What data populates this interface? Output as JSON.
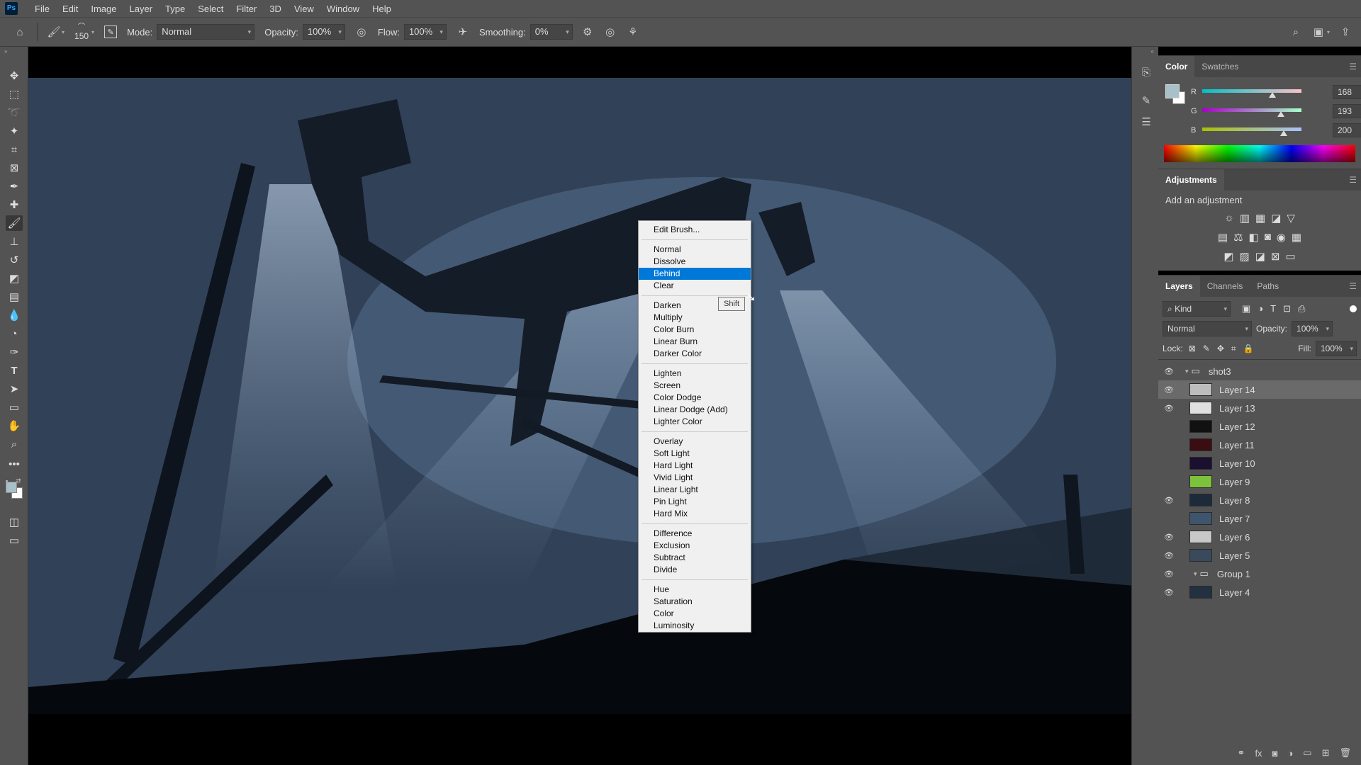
{
  "app_logo": "Ps",
  "menu": [
    "File",
    "Edit",
    "Image",
    "Layer",
    "Type",
    "Select",
    "Filter",
    "3D",
    "View",
    "Window",
    "Help"
  ],
  "options": {
    "brush_size": "150",
    "mode_label": "Mode:",
    "mode_value": "Normal",
    "opacity_label": "Opacity:",
    "opacity_value": "100%",
    "flow_label": "Flow:",
    "flow_value": "100%",
    "smoothing_label": "Smoothing:",
    "smoothing_value": "0%"
  },
  "color_panel": {
    "tabs": [
      "Color",
      "Swatches"
    ],
    "r_label": "R",
    "r_value": "168",
    "g_label": "G",
    "g_value": "193",
    "b_label": "B",
    "b_value": "200",
    "foreground": "#a8c1c8"
  },
  "adjustments_panel": {
    "title": "Adjustments",
    "subtitle": "Add an adjustment"
  },
  "layers_panel": {
    "tabs": [
      "Layers",
      "Channels",
      "Paths"
    ],
    "filter_label": "Kind",
    "blend_mode": "Normal",
    "opacity_label": "Opacity:",
    "opacity_value": "100%",
    "lock_label": "Lock:",
    "fill_label": "Fill:",
    "fill_value": "100%",
    "layers": [
      {
        "name": "shot3",
        "visible": true,
        "type": "group",
        "selected": false
      },
      {
        "name": "Layer 14",
        "visible": true,
        "type": "layer",
        "selected": true,
        "color": "#bdbdbd"
      },
      {
        "name": "Layer 13",
        "visible": true,
        "type": "layer",
        "selected": false,
        "color": "#e0e0e0"
      },
      {
        "name": "Layer 12",
        "visible": false,
        "type": "layer",
        "selected": false,
        "color": "#111111"
      },
      {
        "name": "Layer 11",
        "visible": false,
        "type": "layer",
        "selected": false,
        "color": "#3a0d12"
      },
      {
        "name": "Layer 10",
        "visible": false,
        "type": "layer",
        "selected": false,
        "color": "#1c1030"
      },
      {
        "name": "Layer 9",
        "visible": false,
        "type": "layer",
        "selected": false,
        "color": "#7cc23a"
      },
      {
        "name": "Layer 8",
        "visible": true,
        "type": "layer",
        "selected": false,
        "color": "#1d2a3a"
      },
      {
        "name": "Layer 7",
        "visible": false,
        "type": "layer",
        "selected": false,
        "color": "#3f556d"
      },
      {
        "name": "Layer 6",
        "visible": true,
        "type": "layer",
        "selected": false,
        "color": "#c8c8c8"
      },
      {
        "name": "Layer 5",
        "visible": true,
        "type": "layer",
        "selected": false,
        "color": "#3a4a5c"
      },
      {
        "name": "Group 1",
        "visible": true,
        "type": "group",
        "selected": false
      },
      {
        "name": "Layer 4",
        "visible": true,
        "type": "layer",
        "selected": false,
        "color": "#22303f"
      }
    ]
  },
  "context_menu": {
    "items": [
      {
        "label": "Edit Brush...",
        "group": 0
      },
      {
        "label": "Normal",
        "group": 1
      },
      {
        "label": "Dissolve",
        "group": 1
      },
      {
        "label": "Behind",
        "group": 1,
        "highlighted": true
      },
      {
        "label": "Clear",
        "group": 1
      },
      {
        "label": "Darken",
        "group": 2
      },
      {
        "label": "Multiply",
        "group": 2
      },
      {
        "label": "Color Burn",
        "group": 2
      },
      {
        "label": "Linear Burn",
        "group": 2
      },
      {
        "label": "Darker Color",
        "group": 2
      },
      {
        "label": "Lighten",
        "group": 3
      },
      {
        "label": "Screen",
        "group": 3
      },
      {
        "label": "Color Dodge",
        "group": 3
      },
      {
        "label": "Linear Dodge (Add)",
        "group": 3
      },
      {
        "label": "Lighter Color",
        "group": 3
      },
      {
        "label": "Overlay",
        "group": 4
      },
      {
        "label": "Soft Light",
        "group": 4
      },
      {
        "label": "Hard Light",
        "group": 4
      },
      {
        "label": "Vivid Light",
        "group": 4
      },
      {
        "label": "Linear Light",
        "group": 4
      },
      {
        "label": "Pin Light",
        "group": 4
      },
      {
        "label": "Hard Mix",
        "group": 4
      },
      {
        "label": "Difference",
        "group": 5
      },
      {
        "label": "Exclusion",
        "group": 5
      },
      {
        "label": "Subtract",
        "group": 5
      },
      {
        "label": "Divide",
        "group": 5
      },
      {
        "label": "Hue",
        "group": 6
      },
      {
        "label": "Saturation",
        "group": 6
      },
      {
        "label": "Color",
        "group": 6
      },
      {
        "label": "Luminosity",
        "group": 6
      }
    ],
    "tooltip": "Shift"
  }
}
